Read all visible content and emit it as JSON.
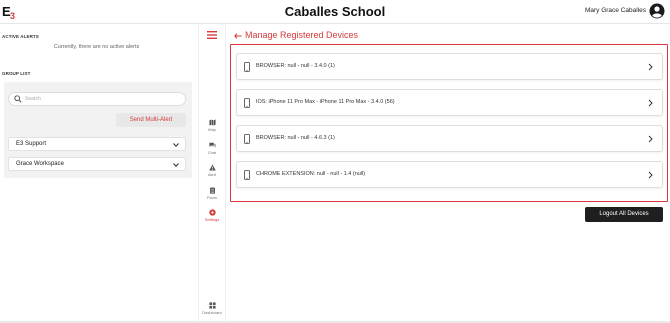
{
  "header": {
    "logo_text": "E3",
    "school_name": "Caballes School",
    "user_name": "Mary Grace Caballes"
  },
  "alerts": {
    "section_label": "ACTIVE ALERTS",
    "empty_message": "Currently, there are no active alerts"
  },
  "group_list": {
    "section_label": "GROUP LIST",
    "search_placeholder": "Search",
    "send_multi_alert_label": "Send Multi-Alert",
    "groups": [
      {
        "label": "E3 Support"
      },
      {
        "label": "Grace Workspace"
      }
    ]
  },
  "nav": {
    "items": [
      {
        "label": "Map",
        "icon": "map-icon"
      },
      {
        "label": "Chat",
        "icon": "chat-icon"
      },
      {
        "label": "Alert",
        "icon": "alert-icon"
      },
      {
        "label": "Plans",
        "icon": "plans-icon"
      },
      {
        "label": "Settings",
        "icon": "settings-icon",
        "active": true
      },
      {
        "label": "Dashboard",
        "icon": "dashboard-icon"
      }
    ]
  },
  "main": {
    "page_title": "Manage Registered Devices",
    "devices": [
      {
        "label": "BROWSER: null - null - 3.4.0 (1)"
      },
      {
        "label": "IOS: iPhone 11 Pro Max - iPhone 11 Pro Max - 3.4.0 (56)"
      },
      {
        "label": "BROWSER: null - null - 4.6.3 (1)"
      },
      {
        "label": "CHROME EXTENSION: null - null - 1.4 (null)"
      }
    ],
    "logout_all_label": "Logout All Devices"
  },
  "colors": {
    "accent": "#d23c3c",
    "dark_button": "#1f1f1f"
  }
}
